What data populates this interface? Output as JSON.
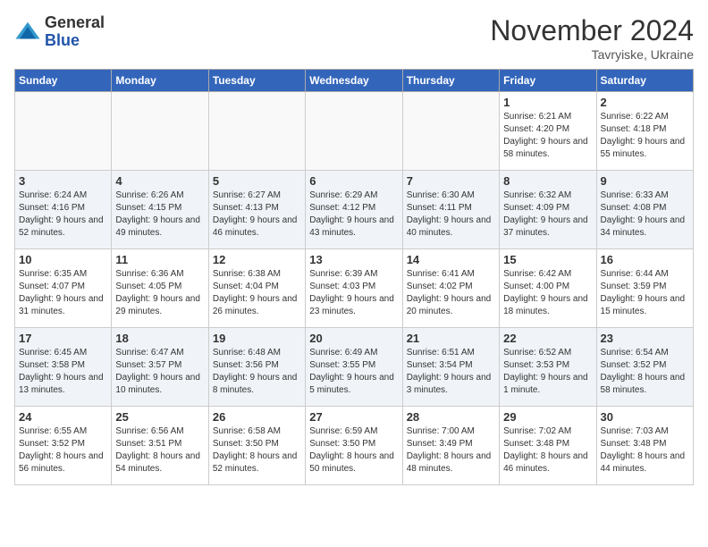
{
  "header": {
    "logo_line1": "General",
    "logo_line2": "Blue",
    "month_title": "November 2024",
    "subtitle": "Tavryiske, Ukraine"
  },
  "weekdays": [
    "Sunday",
    "Monday",
    "Tuesday",
    "Wednesday",
    "Thursday",
    "Friday",
    "Saturday"
  ],
  "weeks": [
    [
      {
        "day": "",
        "info": ""
      },
      {
        "day": "",
        "info": ""
      },
      {
        "day": "",
        "info": ""
      },
      {
        "day": "",
        "info": ""
      },
      {
        "day": "",
        "info": ""
      },
      {
        "day": "1",
        "info": "Sunrise: 6:21 AM\nSunset: 4:20 PM\nDaylight: 9 hours and 58 minutes."
      },
      {
        "day": "2",
        "info": "Sunrise: 6:22 AM\nSunset: 4:18 PM\nDaylight: 9 hours and 55 minutes."
      }
    ],
    [
      {
        "day": "3",
        "info": "Sunrise: 6:24 AM\nSunset: 4:16 PM\nDaylight: 9 hours and 52 minutes."
      },
      {
        "day": "4",
        "info": "Sunrise: 6:26 AM\nSunset: 4:15 PM\nDaylight: 9 hours and 49 minutes."
      },
      {
        "day": "5",
        "info": "Sunrise: 6:27 AM\nSunset: 4:13 PM\nDaylight: 9 hours and 46 minutes."
      },
      {
        "day": "6",
        "info": "Sunrise: 6:29 AM\nSunset: 4:12 PM\nDaylight: 9 hours and 43 minutes."
      },
      {
        "day": "7",
        "info": "Sunrise: 6:30 AM\nSunset: 4:11 PM\nDaylight: 9 hours and 40 minutes."
      },
      {
        "day": "8",
        "info": "Sunrise: 6:32 AM\nSunset: 4:09 PM\nDaylight: 9 hours and 37 minutes."
      },
      {
        "day": "9",
        "info": "Sunrise: 6:33 AM\nSunset: 4:08 PM\nDaylight: 9 hours and 34 minutes."
      }
    ],
    [
      {
        "day": "10",
        "info": "Sunrise: 6:35 AM\nSunset: 4:07 PM\nDaylight: 9 hours and 31 minutes."
      },
      {
        "day": "11",
        "info": "Sunrise: 6:36 AM\nSunset: 4:05 PM\nDaylight: 9 hours and 29 minutes."
      },
      {
        "day": "12",
        "info": "Sunrise: 6:38 AM\nSunset: 4:04 PM\nDaylight: 9 hours and 26 minutes."
      },
      {
        "day": "13",
        "info": "Sunrise: 6:39 AM\nSunset: 4:03 PM\nDaylight: 9 hours and 23 minutes."
      },
      {
        "day": "14",
        "info": "Sunrise: 6:41 AM\nSunset: 4:02 PM\nDaylight: 9 hours and 20 minutes."
      },
      {
        "day": "15",
        "info": "Sunrise: 6:42 AM\nSunset: 4:00 PM\nDaylight: 9 hours and 18 minutes."
      },
      {
        "day": "16",
        "info": "Sunrise: 6:44 AM\nSunset: 3:59 PM\nDaylight: 9 hours and 15 minutes."
      }
    ],
    [
      {
        "day": "17",
        "info": "Sunrise: 6:45 AM\nSunset: 3:58 PM\nDaylight: 9 hours and 13 minutes."
      },
      {
        "day": "18",
        "info": "Sunrise: 6:47 AM\nSunset: 3:57 PM\nDaylight: 9 hours and 10 minutes."
      },
      {
        "day": "19",
        "info": "Sunrise: 6:48 AM\nSunset: 3:56 PM\nDaylight: 9 hours and 8 minutes."
      },
      {
        "day": "20",
        "info": "Sunrise: 6:49 AM\nSunset: 3:55 PM\nDaylight: 9 hours and 5 minutes."
      },
      {
        "day": "21",
        "info": "Sunrise: 6:51 AM\nSunset: 3:54 PM\nDaylight: 9 hours and 3 minutes."
      },
      {
        "day": "22",
        "info": "Sunrise: 6:52 AM\nSunset: 3:53 PM\nDaylight: 9 hours and 1 minute."
      },
      {
        "day": "23",
        "info": "Sunrise: 6:54 AM\nSunset: 3:52 PM\nDaylight: 8 hours and 58 minutes."
      }
    ],
    [
      {
        "day": "24",
        "info": "Sunrise: 6:55 AM\nSunset: 3:52 PM\nDaylight: 8 hours and 56 minutes."
      },
      {
        "day": "25",
        "info": "Sunrise: 6:56 AM\nSunset: 3:51 PM\nDaylight: 8 hours and 54 minutes."
      },
      {
        "day": "26",
        "info": "Sunrise: 6:58 AM\nSunset: 3:50 PM\nDaylight: 8 hours and 52 minutes."
      },
      {
        "day": "27",
        "info": "Sunrise: 6:59 AM\nSunset: 3:50 PM\nDaylight: 8 hours and 50 minutes."
      },
      {
        "day": "28",
        "info": "Sunrise: 7:00 AM\nSunset: 3:49 PM\nDaylight: 8 hours and 48 minutes."
      },
      {
        "day": "29",
        "info": "Sunrise: 7:02 AM\nSunset: 3:48 PM\nDaylight: 8 hours and 46 minutes."
      },
      {
        "day": "30",
        "info": "Sunrise: 7:03 AM\nSunset: 3:48 PM\nDaylight: 8 hours and 44 minutes."
      }
    ]
  ]
}
